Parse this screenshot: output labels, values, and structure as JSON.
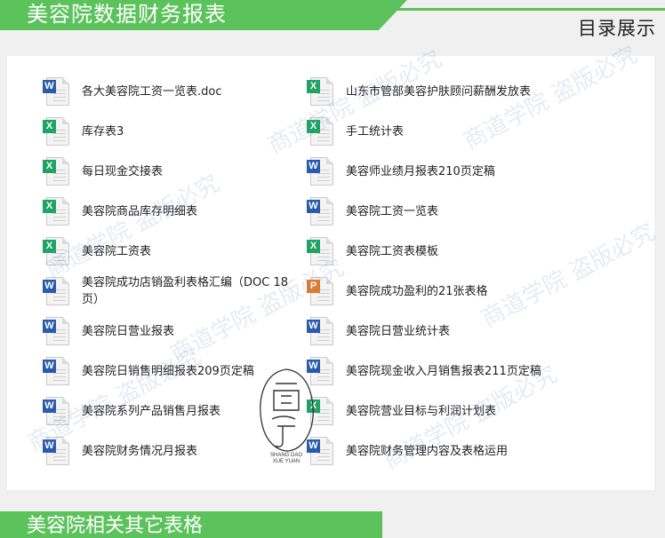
{
  "header": {
    "title": "美容院数据财务报表",
    "toc_label": "目录展示"
  },
  "files": [
    {
      "name": "各大美容院工资一览表.doc",
      "type": "word"
    },
    {
      "name": "山东市管部美容护肤顾问薪酬发放表",
      "type": "excel"
    },
    {
      "name": "库存表3",
      "type": "excel"
    },
    {
      "name": "手工统计表",
      "type": "excel"
    },
    {
      "name": "每日现金交接表",
      "type": "excel"
    },
    {
      "name": "美容师业绩月报表210页定稿",
      "type": "word"
    },
    {
      "name": "美容院商品库存明细表",
      "type": "excel"
    },
    {
      "name": "美容院工资一览表",
      "type": "word"
    },
    {
      "name": "美容院工资表",
      "type": "excel"
    },
    {
      "name": "美容院工资表模板",
      "type": "excel"
    },
    {
      "name": "美容院成功店销盈利表格汇编（DOC 18页）",
      "type": "word"
    },
    {
      "name": "美容院成功盈利的21张表格",
      "type": "ppt"
    },
    {
      "name": "美容院日营业报表",
      "type": "word"
    },
    {
      "name": "美容院日营业统计表",
      "type": "word"
    },
    {
      "name": "美容院日销售明细报表209页定稿",
      "type": "word"
    },
    {
      "name": "美容院现金收入月销售报表211页定稿",
      "type": "word"
    },
    {
      "name": "美容院系列产品销售月报表",
      "type": "word"
    },
    {
      "name": "美容院营业目标与利润计划表",
      "type": "excel"
    },
    {
      "name": "美容院财务情况月报表",
      "type": "word"
    },
    {
      "name": "美容院财务管理内容及表格运用",
      "type": "word"
    }
  ],
  "badges": {
    "word": "W",
    "excel": "X",
    "ppt": "P"
  },
  "section2": {
    "title": "美容院相关其它表格"
  },
  "watermark": {
    "text": "商道学院 盗版必究"
  },
  "seal": {
    "line1": "SHANG DAO",
    "line2": "XUE YUAN"
  },
  "colors": {
    "accent": "#5cc35c",
    "word": "#2b5cab",
    "excel": "#21a366",
    "ppt": "#e07a2c"
  }
}
